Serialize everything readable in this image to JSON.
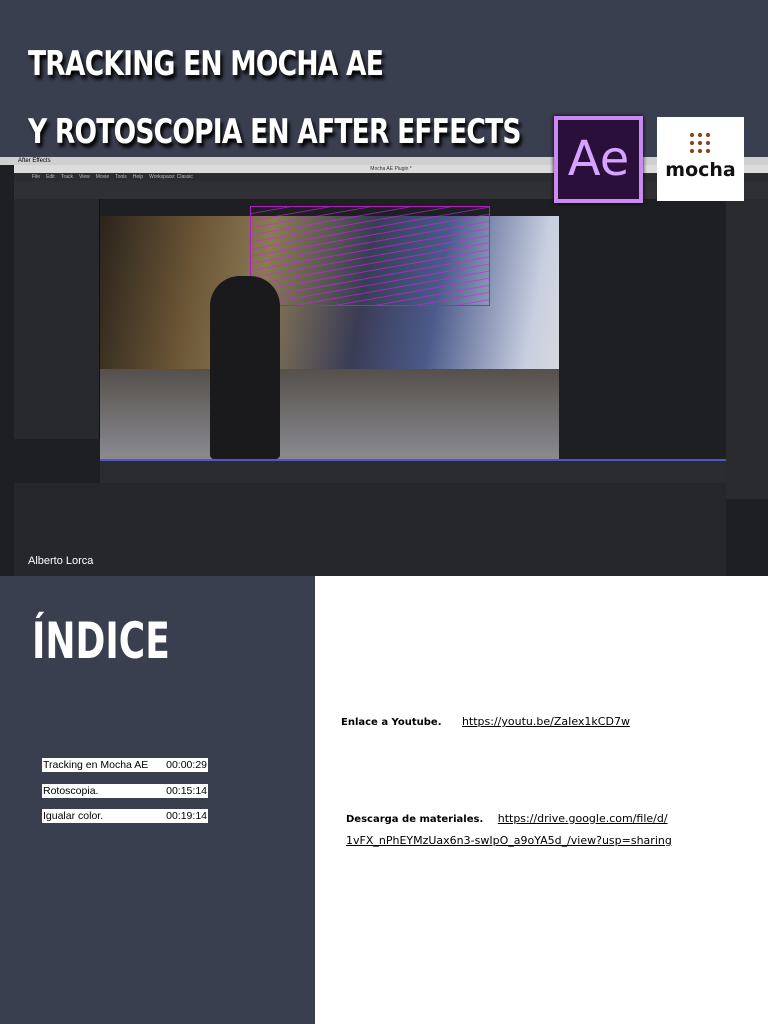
{
  "header": {
    "title_line1": "TRACKING EN MOCHA AE",
    "title_line2": "Y ROTOSCOPIA EN AFTER EFFECTS"
  },
  "screenshot": {
    "app_name": "After Effects",
    "window_title": "Mocha AE Plugin *",
    "menu": [
      "File",
      "Edit",
      "Track",
      "View",
      "Movie",
      "Tools",
      "Help",
      "Workspace: Classic"
    ],
    "author": "Alberto Lorca"
  },
  "logos": {
    "ae": "Ae",
    "mocha": "mocha"
  },
  "index": {
    "title": "ÍNDICE",
    "items": [
      {
        "label": "Tracking en Mocha AE",
        "time": "00:00:29"
      },
      {
        "label": "Rotoscopia.",
        "time": "00:15:14"
      },
      {
        "label": "Igualar color.",
        "time": "00:19:14"
      }
    ]
  },
  "links": {
    "youtube_label": "Enlace a Youtube.",
    "youtube_url": "https://youtu.be/ZaIex1kCD7w",
    "download_label": "Descarga de materiales.",
    "download_url_line1": "https://drive.google.com/file/d/",
    "download_url_line2": "1vFX_nPhEYMzUax6n3-swIpO_a9oYA5d_/view?usp=sharing"
  },
  "colors": {
    "background": "#3a3f4f",
    "ae_border": "#c98af2"
  }
}
